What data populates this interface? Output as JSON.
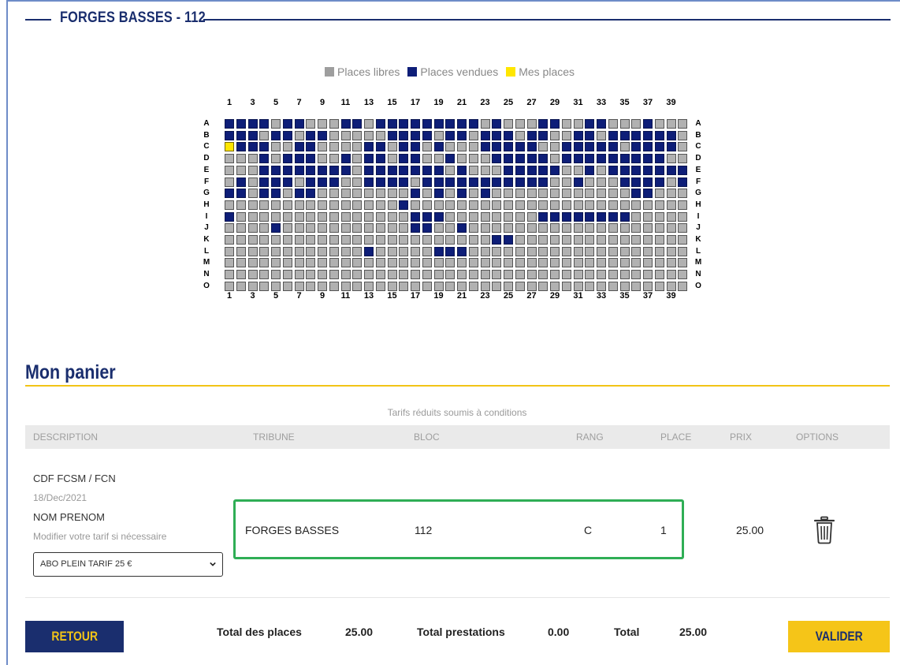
{
  "header": {
    "title": "FORGES BASSES - 112"
  },
  "legend": {
    "items": [
      {
        "label": "Places libres",
        "color": "#b1b1b1"
      },
      {
        "label": "Places vendues",
        "color": "#0e1e78"
      },
      {
        "label": "Mes places",
        "color": "#ffe600"
      }
    ]
  },
  "seat_map": {
    "column_labels": [
      "1",
      "3",
      "5",
      "7",
      "9",
      "11",
      "13",
      "15",
      "17",
      "19",
      "21",
      "23",
      "25",
      "27",
      "29",
      "31",
      "33",
      "35",
      "37",
      "39"
    ],
    "row_labels": [
      "A",
      "B",
      "C",
      "D",
      "E",
      "F",
      "G",
      "H",
      "I",
      "J",
      "K",
      "L",
      "M",
      "N",
      "O"
    ],
    "seats_per_row": 40,
    "sold_seats": {
      "A": [
        1,
        2,
        3,
        4,
        6,
        7,
        11,
        12,
        14,
        15,
        16,
        17,
        18,
        19,
        20,
        21,
        22,
        24,
        28,
        29,
        32,
        33,
        37
      ],
      "B": [
        1,
        2,
        3,
        5,
        6,
        8,
        9,
        15,
        16,
        17,
        18,
        20,
        21,
        23,
        24,
        25,
        27,
        28,
        31,
        32,
        34,
        35,
        36,
        37,
        38,
        39
      ],
      "C": [
        2,
        3,
        4,
        7,
        8,
        13,
        14,
        16,
        17,
        19,
        23,
        24,
        25,
        26,
        27,
        30,
        31,
        32,
        33,
        34,
        36,
        37,
        38,
        39
      ],
      "D": [
        4,
        6,
        7,
        8,
        11,
        13,
        14,
        16,
        17,
        20,
        24,
        25,
        26,
        27,
        28,
        30,
        31,
        32,
        33,
        34,
        35,
        36,
        37,
        38
      ],
      "E": [
        4,
        5,
        6,
        7,
        8,
        9,
        10,
        11,
        13,
        14,
        15,
        16,
        17,
        18,
        19,
        21,
        25,
        26,
        27,
        28,
        29,
        32,
        34,
        35,
        36,
        37,
        38,
        39,
        40
      ],
      "F": [
        2,
        4,
        5,
        6,
        8,
        9,
        10,
        13,
        14,
        15,
        16,
        18,
        19,
        20,
        21,
        22,
        23,
        24,
        25,
        26,
        27,
        28,
        31,
        35,
        36,
        37,
        38,
        40
      ],
      "G": [
        1,
        2,
        4,
        5,
        7,
        8,
        17,
        19,
        21,
        23,
        36,
        37
      ],
      "H": [
        16
      ],
      "I": [
        1,
        17,
        18,
        19,
        28,
        29,
        30,
        31,
        32,
        33,
        34,
        35
      ],
      "J": [
        5,
        17,
        18,
        21
      ],
      "K": [
        24,
        25
      ],
      "L": [
        13,
        19,
        20,
        21
      ],
      "M": [],
      "N": [],
      "O": []
    },
    "my_seats": {
      "C": [
        1
      ]
    }
  },
  "cart": {
    "title": "Mon panier",
    "note": "Tarifs réduits soumis à conditions",
    "columns": [
      "DESCRIPTION",
      "TRIBUNE",
      "BLOC",
      "RANG",
      "PLACE",
      "PRIX",
      "OPTIONS"
    ],
    "item": {
      "event": "CDF FCSM / FCN",
      "date": "18/Dec/2021",
      "holder": "NOM PRENOM",
      "hint": "Modifier votre tarif si nécessaire",
      "tarif_selected": "ABO PLEIN TARIF 25 €",
      "tribune": "FORGES BASSES",
      "bloc": "112",
      "rang": "C",
      "place": "1",
      "prix": "25.00",
      "delete_icon": "trash-icon"
    }
  },
  "totals": {
    "places_label": "Total des places",
    "places_value": "25.00",
    "prestations_label": "Total prestations",
    "prestations_value": "0.00",
    "total_label": "Total",
    "total_value": "25.00"
  },
  "buttons": {
    "retour": "RETOUR",
    "valider": "VALIDER"
  },
  "colors": {
    "navy": "#1a2e6e",
    "accent_yellow": "#f5c518",
    "highlight_green": "#2fae55"
  }
}
